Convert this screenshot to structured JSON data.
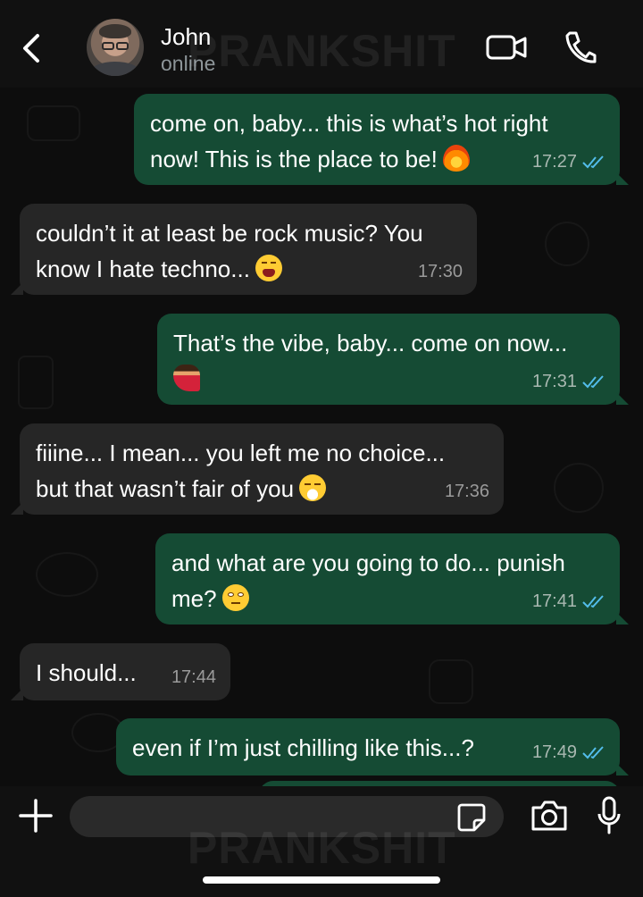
{
  "header": {
    "contact_name": "John",
    "contact_status": "online",
    "back_icon": "chevron-left-icon",
    "video_icon": "video-camera-icon",
    "call_icon": "phone-icon"
  },
  "watermark": "PRANKSHIT",
  "messages": [
    {
      "direction": "outgoing",
      "text": "come on, baby... this is what’s hot right\nnow! This is the place to be!",
      "emoji": "fire",
      "time": "17:27",
      "read": true
    },
    {
      "direction": "incoming",
      "text": "couldn’t it at least be rock music? You\nknow I hate techno...",
      "emoji": "tired-face",
      "time": "17:30"
    },
    {
      "direction": "outgoing",
      "text": "That’s the vibe, baby... come on now...",
      "emoji": "dancer",
      "time": "17:31",
      "read": true
    },
    {
      "direction": "incoming",
      "text": "fiiine... I mean... you left me no choice...\nbut that wasn’t fair of you",
      "emoji": "huffing-face",
      "time": "17:36"
    },
    {
      "direction": "outgoing",
      "text": "and what are you going to do... punish\nme?",
      "emoji": "flushed-face",
      "time": "17:41",
      "read": true
    },
    {
      "direction": "incoming",
      "text": "I should...",
      "time": "17:44"
    },
    {
      "direction": "outgoing",
      "text": "even if I’m just chilling like this...?",
      "time": "17:49",
      "read": true
    }
  ],
  "composer": {
    "placeholder": "",
    "plus_icon": "plus-icon",
    "sticker_icon": "sticker-icon",
    "camera_icon": "camera-icon",
    "mic_icon": "microphone-icon"
  },
  "colors": {
    "outgoing_bubble": "#154b34",
    "incoming_bubble": "#262626",
    "read_tick": "#53bdeb",
    "background": "#0d0d0d"
  }
}
